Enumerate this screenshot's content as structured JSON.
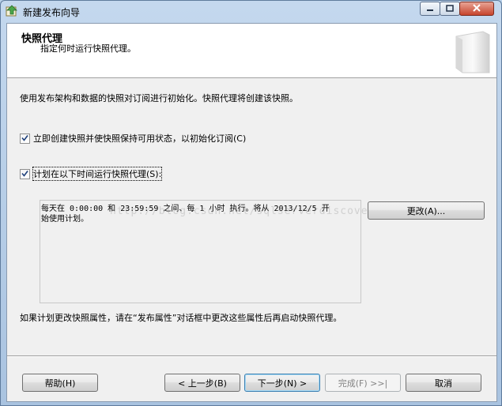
{
  "window": {
    "title": "新建发布向导",
    "controls": {
      "minimize": "minimize",
      "maximize": "maximize",
      "close": "close"
    }
  },
  "header": {
    "title": "快照代理",
    "subtitle": "指定何时运行快照代理。"
  },
  "main": {
    "description": "使用发布架构和数据的快照对订阅进行初始化。快照代理将创建该快照。",
    "options": [
      {
        "label": "立即创建快照并使快照保持可用状态，以初始化订阅(C)",
        "checked": true
      },
      {
        "label": "计划在以下时间运行快照代理(S):",
        "checked": true
      }
    ],
    "schedule_lines": [
      "每天在 0:00:00 和 23:59:59 之间、每 1 小时 执行。将从 2013/12/5 开",
      "始使用计划。"
    ],
    "change_button": "更改(A)...",
    "footer_note": "如果计划更改快照属性，请在“发布属性”对话框中更改这些属性后再启动快照代理。",
    "watermark": "http://blog.csdn.net/sqlserverdiscovery"
  },
  "buttons": {
    "help": "帮助(H)",
    "back": "< 上一步(B)",
    "next": "下一步(N) >",
    "finish": "完成(F) >>|",
    "cancel": "取消"
  },
  "colors": {
    "accent": "#3c7fb1",
    "close": "#c7442d",
    "disabled_text": "#838383"
  }
}
